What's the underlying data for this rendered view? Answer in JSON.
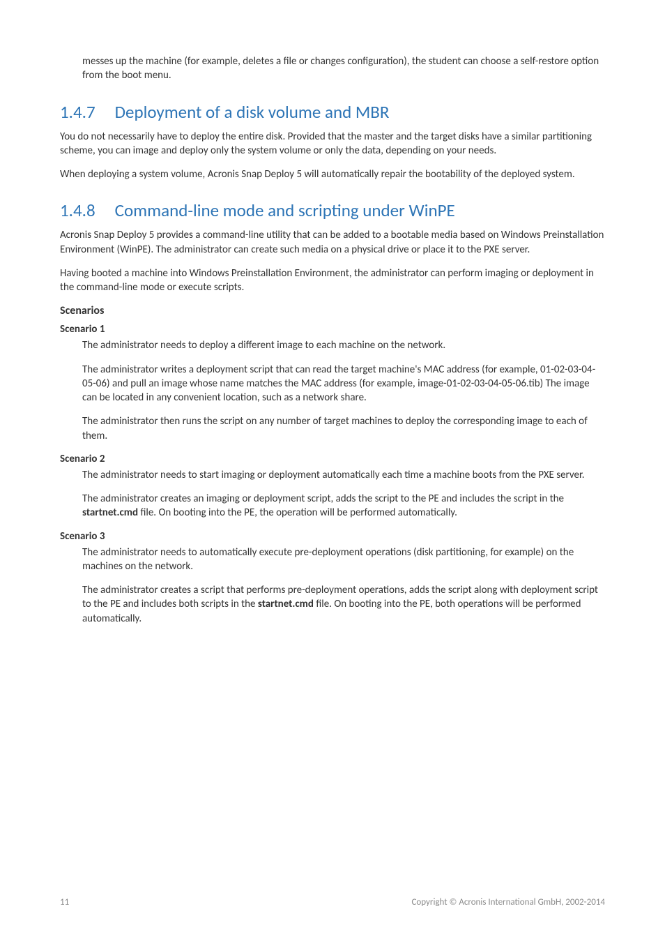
{
  "intro_para": "messes up the machine (for example, deletes a file or changes configuration), the student can choose a self-restore option from the boot menu.",
  "sec147": {
    "num": "1.4.7",
    "title": "Deployment of a disk volume and MBR",
    "p1": "You do not necessarily have to deploy the entire disk. Provided that the master and the target disks have a similar partitioning scheme, you can image and deploy only the system volume or only the data, depending on your needs.",
    "p2": "When deploying a system volume, Acronis Snap Deploy 5 will automatically repair the bootability of the deployed system."
  },
  "sec148": {
    "num": "1.4.8",
    "title": "Command-line mode and scripting under WinPE",
    "p1": "Acronis Snap Deploy 5 provides a command-line utility that can be added to a bootable media based on Windows Preinstallation Environment (WinPE). The administrator can create such media on a physical drive or place it to the PXE server.",
    "p2": "Having booted a machine into Windows Preinstallation Environment, the administrator can perform imaging or deployment in the command-line mode or execute scripts.",
    "scen_heading": "Scenarios",
    "s1": {
      "title": "Scenario 1",
      "p1": "The administrator needs to deploy a different image to each machine on the network.",
      "p2": "The administrator writes a deployment script that can read the target machine's MAC address (for example, 01-02-03-04-05-06) and pull an image whose name matches the MAC address (for example, image-01-02-03-04-05-06.tib) The image can be located in any convenient location, such as a network share.",
      "p3": "The administrator then runs the script on any number of target machines to deploy the corresponding image to each of them."
    },
    "s2": {
      "title": "Scenario 2",
      "p1": "The administrator needs to start imaging or deployment automatically each time a machine boots from the PXE server.",
      "p2_a": "The administrator creates an imaging or deployment script, adds the script to the PE and includes the script in the ",
      "p2_bold": "startnet.cmd",
      "p2_b": " file. On booting into the PE, the operation will be performed automatically."
    },
    "s3": {
      "title": "Scenario 3",
      "p1": "The administrator needs to automatically execute pre-deployment operations (disk partitioning, for example) on the machines on the network.",
      "p2_a": "The administrator creates a script that performs pre-deployment operations, adds the script along with deployment script to the PE and includes both scripts in the ",
      "p2_bold": "startnet.cmd",
      "p2_b": " file. On booting into the PE, both operations will be performed automatically."
    }
  },
  "footer": {
    "page": "11",
    "copyright": "Copyright © Acronis International GmbH, 2002-2014"
  }
}
